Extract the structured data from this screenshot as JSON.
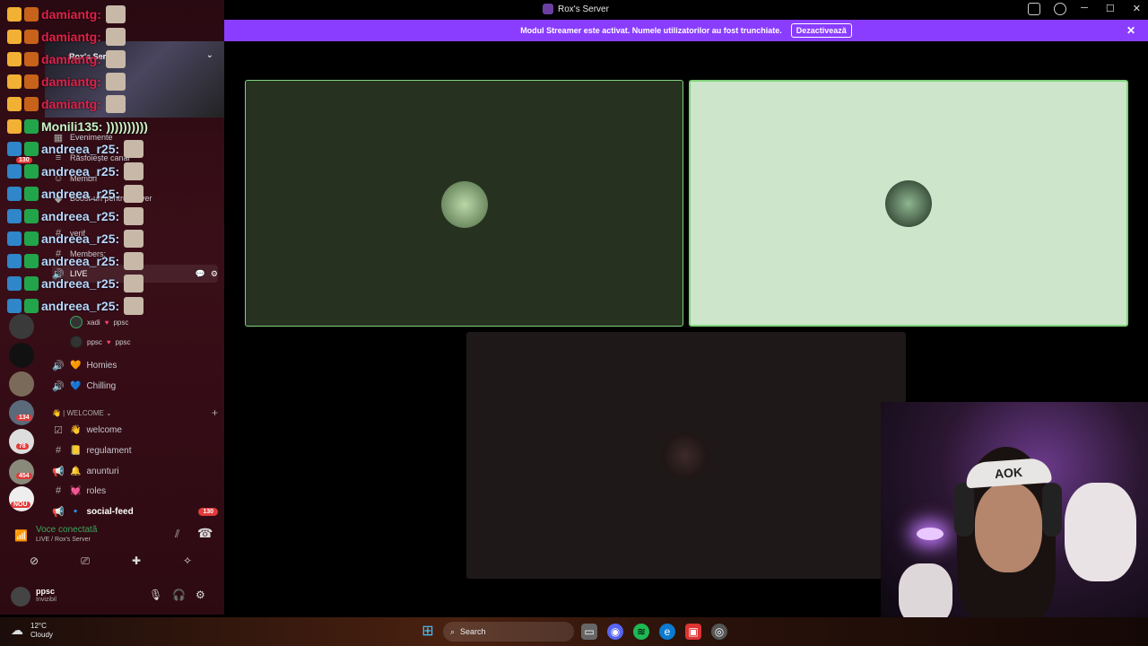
{
  "window": {
    "title": "Rox's Server",
    "controls": [
      "─",
      "☐",
      "✕"
    ]
  },
  "banner": {
    "text": "Modul Streamer este activat. Numele utilizatorilor au fost trunchiate.",
    "button": "Dezactivează"
  },
  "server": {
    "name": "Rox's Server"
  },
  "chat_overlay": [
    {
      "name": "damiantg:",
      "color": "#e0214a"
    },
    {
      "name": "damiantg:",
      "color": "#e0214a"
    },
    {
      "name": "damiantg:",
      "color": "#e0214a"
    },
    {
      "name": "damiantg:",
      "color": "#e0214a"
    },
    {
      "name": "damiantg:",
      "color": "#e0214a"
    },
    {
      "name": "Monili135: ))))))))))",
      "color": "#c8f5c8"
    },
    {
      "name": "andreea_r25:",
      "color": "#b8d8ff"
    },
    {
      "name": "andreea_r25:",
      "color": "#b8d8ff"
    },
    {
      "name": "andreea_r25:",
      "color": "#b8d8ff"
    },
    {
      "name": "andreea_r25:",
      "color": "#b8d8ff"
    },
    {
      "name": "andreea_r25:",
      "color": "#b8d8ff"
    },
    {
      "name": "andreea_r25:",
      "color": "#b8d8ff"
    },
    {
      "name": "andreea_r25:",
      "color": "#b8d8ff"
    },
    {
      "name": "andreea_r25:",
      "color": "#b8d8ff"
    }
  ],
  "guild_badges": [
    "130",
    "134",
    "78",
    "454",
    "NOU"
  ],
  "channels_top": [
    "Evenimente",
    "Răsfoiește canal",
    "Membri",
    "Boost-uri pentru server",
    "verif",
    "Members: ",
    "LIVE"
  ],
  "voice_users": [
    {
      "name": "xadi",
      "tag": "ppsc"
    },
    {
      "name": "ppsc",
      "tag": "ppsc"
    }
  ],
  "voice_channels": [
    {
      "icon": "🔊",
      "emoji": "🧡",
      "label": "Homies"
    },
    {
      "icon": "🔊",
      "emoji": "💙",
      "label": "Chilling"
    }
  ],
  "category": {
    "label": "👋 | WELCOME ⌄",
    "add": "+"
  },
  "text_channels": [
    {
      "icon": "☑",
      "emoji": "👋",
      "label": "welcome"
    },
    {
      "icon": "#",
      "emoji": "📒",
      "label": "regulament"
    },
    {
      "icon": "📢",
      "emoji": "🔔",
      "label": "anunturi"
    },
    {
      "icon": "#",
      "emoji": "💓",
      "label": "roles"
    },
    {
      "icon": "📢",
      "emoji": "🔹",
      "label": "social-feed",
      "count": "130"
    }
  ],
  "voice_panel": {
    "status": "Voce conectată",
    "location": "LIVE / Rox's Server"
  },
  "user": {
    "name": "ppsc",
    "status": "Invizibil"
  },
  "taskbar": {
    "temp": "12°C",
    "weather": "Cloudy",
    "search": "Search"
  },
  "cam": {
    "band_text": "AOK"
  },
  "colors": {
    "accent": "#8a3dff",
    "tile1": "#26321f",
    "tile2": "#cde6cb",
    "tile3": "#1e1818",
    "border_active": "#7fd37a"
  }
}
